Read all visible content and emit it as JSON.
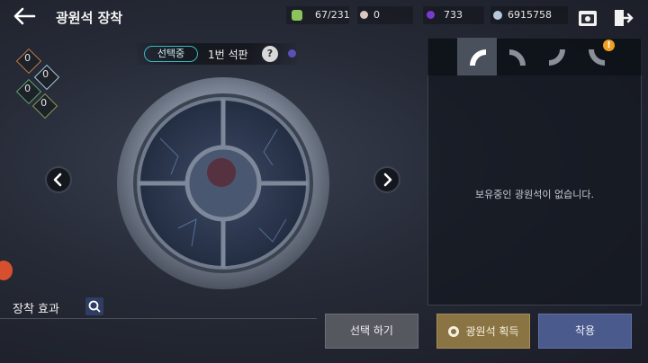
{
  "header": {
    "title": "광원석 장착"
  },
  "resources": [
    {
      "name": "stamina",
      "value": "67/231",
      "icon": "green-gem-icon",
      "color": "#8cc35a"
    },
    {
      "name": "pearl",
      "value": "0",
      "icon": "pearl-icon",
      "color": "#d8c8c0"
    },
    {
      "name": "crystal",
      "value": "733",
      "icon": "purple-crystal-icon",
      "color": "#7a3ad0"
    },
    {
      "name": "silver",
      "value": "6915758",
      "icon": "silver-coin-icon",
      "color": "#b8c8dc"
    }
  ],
  "slots": [
    {
      "label": "0",
      "icon": "fire-rune-icon"
    },
    {
      "label": "0",
      "icon": "light-rune-icon"
    },
    {
      "label": "0",
      "icon": "nature-rune-icon"
    },
    {
      "label": "0",
      "icon": "earth-rune-icon"
    }
  ],
  "selection": {
    "badge": "선택중",
    "tablet_name": "1번 석판",
    "help": "?"
  },
  "effects": {
    "label": "장착 효과"
  },
  "buttons": {
    "select": "선택 하기",
    "acquire": "광원석 획득",
    "equip": "착용"
  },
  "panel": {
    "empty_message": "보유중인 광원석이 없습니다.",
    "alert": "!"
  },
  "colors": {
    "accent_teal": "#37b8c4",
    "gold_button": "#8a7443",
    "blue_button": "#4a5a8c",
    "alert": "#f0a020"
  }
}
